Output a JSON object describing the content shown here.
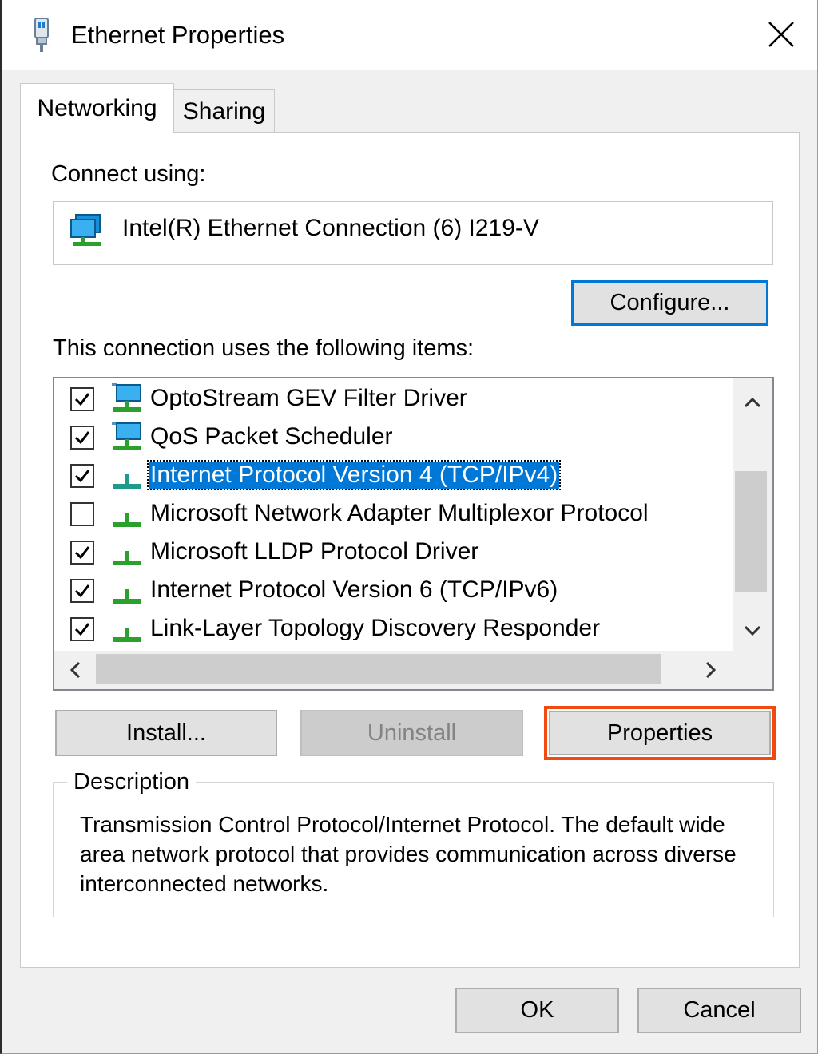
{
  "window": {
    "title": "Ethernet Properties",
    "close_icon": "close-icon"
  },
  "tabs": [
    {
      "label": "Networking",
      "selected": true
    },
    {
      "label": "Sharing",
      "selected": false
    }
  ],
  "networking": {
    "connect_using_label": "Connect using:",
    "adapter_name": "Intel(R) Ethernet Connection (6) I219-V",
    "configure_label": "Configure...",
    "items_label": "This connection uses the following items:",
    "items": [
      {
        "label": "OptoStream GEV Filter Driver",
        "checked": true,
        "icon": "network-service-icon",
        "selected": false
      },
      {
        "label": "QoS Packet Scheduler",
        "checked": true,
        "icon": "network-service-icon",
        "selected": false
      },
      {
        "label": "Internet Protocol Version 4 (TCP/IPv4)",
        "checked": true,
        "icon": "protocol-icon",
        "selected": true
      },
      {
        "label": "Microsoft Network Adapter Multiplexor Protocol",
        "checked": false,
        "icon": "protocol-icon",
        "selected": false
      },
      {
        "label": "Microsoft LLDP Protocol Driver",
        "checked": true,
        "icon": "protocol-icon",
        "selected": false
      },
      {
        "label": "Internet Protocol Version 6 (TCP/IPv6)",
        "checked": true,
        "icon": "protocol-icon",
        "selected": false
      },
      {
        "label": "Link-Layer Topology Discovery Responder",
        "checked": true,
        "icon": "protocol-icon",
        "selected": false
      }
    ],
    "install_label": "Install...",
    "uninstall_label": "Uninstall",
    "properties_label": "Properties",
    "description_legend": "Description",
    "description_text": "Transmission Control Protocol/Internet Protocol. The default wide area network protocol that provides communication across diverse interconnected networks."
  },
  "footer": {
    "ok_label": "OK",
    "cancel_label": "Cancel"
  },
  "colors": {
    "selection": "#0078d7",
    "focus_border": "#0078d7",
    "highlight_border": "#f04a10"
  }
}
